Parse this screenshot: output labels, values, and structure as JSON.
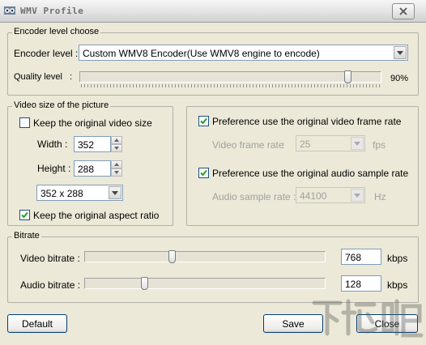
{
  "window": {
    "title": "WMV Profile"
  },
  "encoder_group": {
    "title": "Encoder level choose",
    "encoder_label": "Encoder level :",
    "encoder_value": "Custom WMV8 Encoder(Use WMV8 engine to encode)",
    "quality_label": "Quality level",
    "quality_colon": ":",
    "quality_value": "90%",
    "quality_fraction": 0.9
  },
  "video_size_group": {
    "title": "Video size of the picture",
    "keep_original_label": "Keep the original video size",
    "keep_original_checked": false,
    "width_label": "Width :",
    "width_value": "352",
    "height_label": "Height :",
    "height_value": "288",
    "size_preset": "352 x 288",
    "keep_aspect_label": "Keep the original aspect ratio",
    "keep_aspect_checked": true
  },
  "rate_group": {
    "pref_frame_rate_label": "Preference use the original video frame rate",
    "pref_frame_rate_checked": true,
    "frame_rate_label": "Video frame rate",
    "frame_rate_colon": ":",
    "frame_rate_value": "25",
    "frame_rate_unit": "fps",
    "pref_sample_rate_label": "Preference use the original audio sample rate",
    "pref_sample_rate_checked": true,
    "sample_rate_label": "Audio sample rate :",
    "sample_rate_value": "44100",
    "sample_rate_unit": "Hz"
  },
  "bitrate_group": {
    "title": "Bitrate",
    "video_label": "Video bitrate :",
    "video_value": "768",
    "video_unit": "kbps",
    "video_fraction": 0.36,
    "audio_label": "Audio bitrate :",
    "audio_value": "128",
    "audio_unit": "kbps",
    "audio_fraction": 0.24
  },
  "buttons": {
    "default": "Default",
    "save": "Save",
    "close": "Close"
  },
  "watermark": {
    "text": "下载吧"
  }
}
